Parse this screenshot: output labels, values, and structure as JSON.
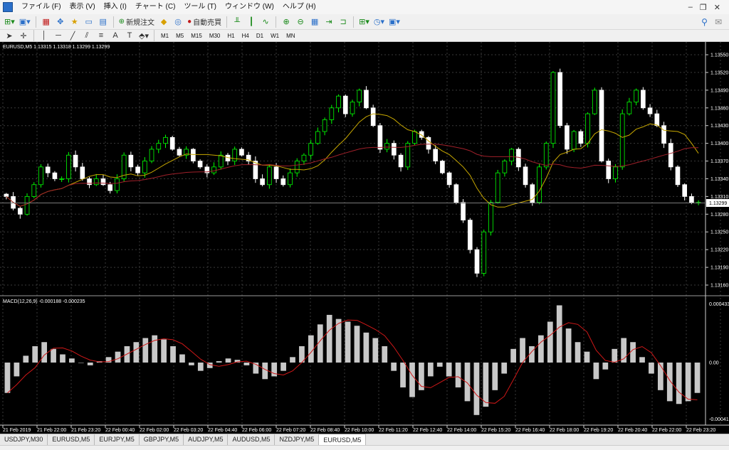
{
  "menu": {
    "items": [
      "ファイル (F)",
      "表示 (V)",
      "挿入 (I)",
      "チャート (C)",
      "ツール (T)",
      "ウィンドウ (W)",
      "ヘルプ (H)"
    ]
  },
  "toolbar": {
    "new_order_label": "新規注文",
    "autotrade_label": "自動売買",
    "text_tool_label": "A",
    "timeframes": [
      "M1",
      "M5",
      "M15",
      "M30",
      "H1",
      "H4",
      "D1",
      "W1",
      "MN"
    ]
  },
  "main_chart": {
    "header": "EURUSD,M5  1.13315 1.13318 1.13299 1.13299",
    "price_labels": [
      "1.13550",
      "1.13520",
      "1.13490",
      "1.13460",
      "1.13430",
      "1.13400",
      "1.13370",
      "1.13340",
      "1.13310",
      "1.13280",
      "1.13250",
      "1.13220",
      "1.13190",
      "1.13160"
    ],
    "current_price": "1.13299",
    "colors": {
      "bull": "#00ff00",
      "bear": "#ffffff",
      "ma_fast": "#c8a800",
      "ma_slow": "#a0202a",
      "grid": "#3a3a3a",
      "current_line": "#7a7a7a"
    },
    "ohlc_close_series": [
      1.1331,
      1.1329,
      1.1328,
      1.1331,
      1.1333,
      1.1336,
      1.1335,
      1.1334,
      1.1334,
      1.1338,
      1.1336,
      1.1334,
      1.1333,
      1.1334,
      1.1333,
      1.1332,
      1.1334,
      1.1338,
      1.1336,
      1.1335,
      1.1337,
      1.1339,
      1.134,
      1.1341,
      1.1339,
      1.1338,
      1.1339,
      1.1337,
      1.1336,
      1.1335,
      1.1336,
      1.1338,
      1.1337,
      1.1339,
      1.1338,
      1.1337,
      1.1334,
      1.1333,
      1.1336,
      1.1334,
      1.1333,
      1.1335,
      1.1337,
      1.1338,
      1.134,
      1.1342,
      1.1344,
      1.1346,
      1.1348,
      1.1345,
      1.1347,
      1.1349,
      1.1346,
      1.1343,
      1.1339,
      1.134,
      1.1338,
      1.1336,
      1.134,
      1.1342,
      1.1341,
      1.1339,
      1.1337,
      1.1335,
      1.1333,
      1.133,
      1.1327,
      1.1322,
      1.1318,
      1.1325,
      1.133,
      1.1335,
      1.1337,
      1.1339,
      1.1336,
      1.1333,
      1.133,
      1.1336,
      1.134,
      1.1352,
      1.1343,
      1.1339,
      1.1342,
      1.134,
      1.1345,
      1.1349,
      1.1337,
      1.1334,
      1.1336,
      1.1345,
      1.1347,
      1.1349,
      1.1346,
      1.1345,
      1.1343,
      1.134,
      1.1336,
      1.1333,
      1.1331,
      1.133,
      1.133
    ]
  },
  "macd": {
    "header": "MACD(12,26,9) -0.000188 -0.000235",
    "labels": {
      "top": "0.000433",
      "zero": "0.00",
      "bottom": "-0.000412"
    },
    "histogram": [
      -0.00022,
      -0.0001,
      5e-05,
      0.00012,
      0.00015,
      0.0001,
      6e-05,
      3e-05,
      0.0,
      -2e-05,
      1e-05,
      4e-05,
      8e-05,
      0.00012,
      0.00015,
      0.00018,
      0.0002,
      0.00017,
      0.00012,
      6e-05,
      -2e-05,
      -6e-05,
      -4e-05,
      1e-05,
      3e-05,
      2e-05,
      -2e-05,
      -8e-05,
      -0.00012,
      -0.0001,
      -6e-05,
      4e-05,
      0.00012,
      0.0002,
      0.00028,
      0.00035,
      0.00032,
      0.0003,
      0.00027,
      0.00022,
      0.00018,
      0.00012,
      -6e-05,
      -0.00018,
      -0.00025,
      -0.0002,
      -0.0001,
      -3e-05,
      -0.0001,
      -0.00018,
      -0.00028,
      -0.00038,
      -0.00032,
      -0.0002,
      -8e-05,
      0.0001,
      0.00018,
      0.00012,
      0.0002,
      0.0003,
      0.00042,
      0.00025,
      0.00015,
      8e-05,
      -0.00012,
      -5e-05,
      0.0001,
      0.00018,
      0.00015,
      4e-05,
      -8e-05,
      -0.0002,
      -0.00028,
      -0.0003,
      -0.00028,
      -0.00022
    ],
    "colors": {
      "hist": "#c8c8c8",
      "signal": "#d01818"
    }
  },
  "time_labels": [
    "21 Feb 2019",
    "21 Feb 22:00",
    "21 Feb 23:20",
    "22 Feb 00:40",
    "22 Feb 02:00",
    "22 Feb 03:20",
    "22 Feb 04:40",
    "22 Feb 06:00",
    "22 Feb 07:20",
    "22 Feb 08:40",
    "22 Feb 10:00",
    "22 Feb 11:20",
    "22 Feb 12:40",
    "22 Feb 14:00",
    "22 Feb 15:20",
    "22 Feb 16:40",
    "22 Feb 18:00",
    "22 Feb 19:20",
    "22 Feb 20:40",
    "22 Feb 22:00",
    "22 Feb 23:20"
  ],
  "tabs": [
    "USDJPY,M30",
    "EURUSD,M5",
    "EURJPY,M5",
    "GBPJPY,M5",
    "AUDJPY,M5",
    "AUDUSD,M5",
    "NZDJPY,M5",
    "EURUSD,M5"
  ],
  "active_tab_index": 7
}
